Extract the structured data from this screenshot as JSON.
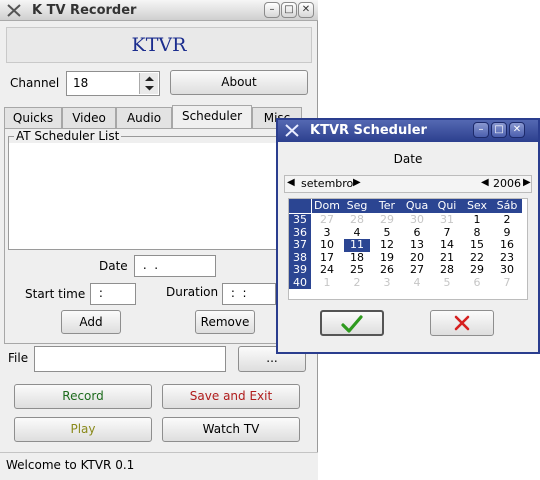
{
  "main": {
    "title": "K TV Recorder",
    "banner": "KTVR",
    "channel_label": "Channel",
    "channel_value": "18",
    "about_button": "About",
    "tabs": [
      "Quicks",
      "Video",
      "Audio",
      "Scheduler",
      "Misc"
    ],
    "active_tab": "Scheduler",
    "group_title": "AT Scheduler List",
    "date_label": "Date",
    "date_value": " .  .",
    "start_time_label": "Start time",
    "start_time_value": " :",
    "duration_label": "Duration",
    "duration_value": " :  :",
    "add_button": "Add",
    "remove_button": "Remove",
    "file_label": "File",
    "file_value": "",
    "browse_button": "...",
    "record_button": "Record",
    "save_exit_button": "Save and Exit",
    "play_button": "Play",
    "watch_tv_button": "Watch TV",
    "status": "Welcome to KTVR 0.1"
  },
  "scheduler": {
    "title": "KTVR Scheduler",
    "section_label": "Date",
    "month": "setembro",
    "year": "2006",
    "weekdays": [
      "Dom",
      "Seg",
      "Ter",
      "Qua",
      "Qui",
      "Sex",
      "Sáb"
    ],
    "weeks": [
      "35",
      "36",
      "37",
      "38",
      "39",
      "40"
    ],
    "days": [
      [
        "27",
        "28",
        "29",
        "30",
        "31",
        "1",
        "2"
      ],
      [
        "3",
        "4",
        "5",
        "6",
        "7",
        "8",
        "9"
      ],
      [
        "10",
        "11",
        "12",
        "13",
        "14",
        "15",
        "16"
      ],
      [
        "17",
        "18",
        "19",
        "20",
        "21",
        "22",
        "23"
      ],
      [
        "24",
        "25",
        "26",
        "27",
        "28",
        "29",
        "30"
      ],
      [
        "1",
        "2",
        "3",
        "4",
        "5",
        "6",
        "7"
      ]
    ],
    "selected_day": "11",
    "ok_icon": "check-icon",
    "cancel_icon": "x-icon",
    "colors": {
      "accent": "#2b4592",
      "ok": "#2e9a1e",
      "cancel": "#d62020"
    }
  }
}
